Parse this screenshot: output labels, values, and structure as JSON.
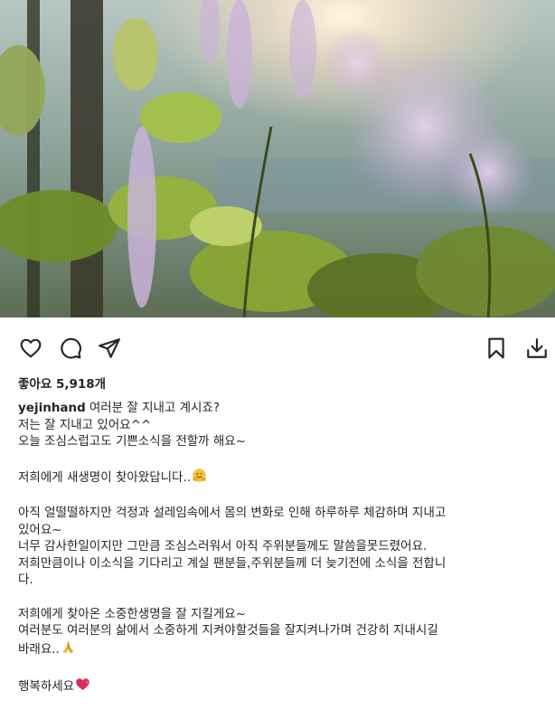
{
  "post": {
    "likes_label": "좋아요 5,918개",
    "username": "yejinhand",
    "caption_first": "여러분 잘 지내고 계시죠?",
    "caption_lines": [
      "저는 잘 지내고 있어요^^",
      "오늘 조심스럽고도 기쁜소식을 전할까 해요~",
      "",
      "저희에게 새생명이 찾아왔답니다..",
      "",
      "아직 얼떨떨하지만 걱정과 설레임속에서 몸의 변화로 인해 하루하루 체감하며 지내고",
      "있어요~",
      "너무 감사한일이지만 그만큼 조심스러워서 아직 주위분들께도 말씀을못드렸어요.",
      "저희만큼이나 이소식을 기다리고 계실 팬분들,주위분들께 더 늦기전에 소식을 전합니",
      "다.",
      "",
      "저희에게 찾아온 소중한생명을 잘 지킬게요~",
      "여러분도 여러분의 삶에서 소중하게 지켜야할것들을 잘지켜나가며 건강히 지내시길",
      "바래요..",
      "",
      "행복하세요"
    ]
  },
  "icons": {
    "like": "heart-icon",
    "comment": "comment-bubble-icon",
    "share": "paper-plane-icon",
    "save": "bookmark-icon",
    "download": "download-icon",
    "emoji_hug": "hugging-face-emoji",
    "emoji_pray": "folded-hands-emoji",
    "emoji_heart": "heart-emoji"
  },
  "colors": {
    "text": "#262626",
    "icon": "#262626",
    "heart_emoji": "#d62d5a"
  }
}
